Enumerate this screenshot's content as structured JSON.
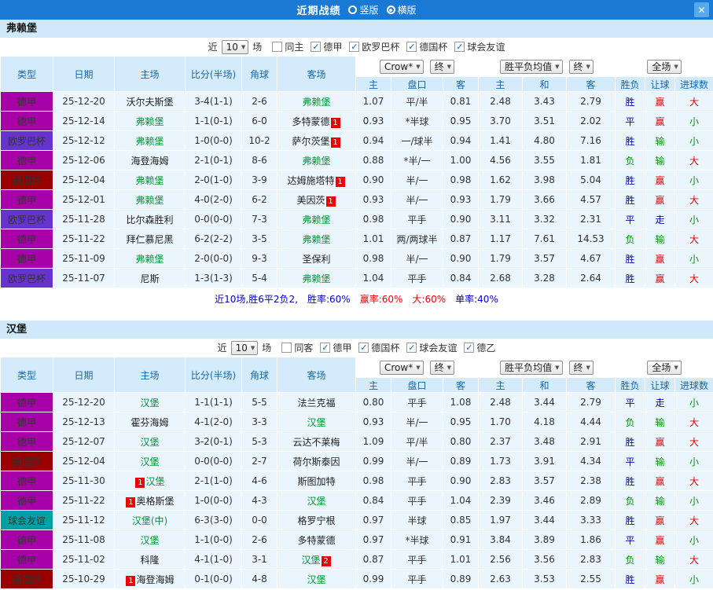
{
  "topbar": {
    "title": "近期战绩",
    "radios": [
      {
        "label": "竖版",
        "selected": false
      },
      {
        "label": "横版",
        "selected": true
      }
    ],
    "close_icon": "✕"
  },
  "filter_near": "近",
  "filter_games": "场",
  "table_header": {
    "type": "类型",
    "date": "日期",
    "home": "主场",
    "score": "比分(半场)",
    "corner": "角球",
    "away": "客场",
    "odds_select": "Crow*",
    "odds_final_select": "终",
    "avg_select": "胜平负均值",
    "avg_final_select": "终",
    "scope_select": "全场",
    "sub": [
      "主",
      "盘口",
      "客",
      "主",
      "和",
      "客",
      "胜负",
      "让球",
      "进球数"
    ]
  },
  "type_colors": {
    "德甲": "#a800a8",
    "欧罗巴杯": "#6633cc",
    "德国杯": "#990000",
    "球会友谊": "#00a0a5"
  },
  "result_colors": {
    "胜": "#0000dd",
    "平": "#0000dd",
    "负": "#009900",
    "赢": "#ee0000",
    "输": "#009900",
    "走": "#0000dd",
    "大": "#ee0000",
    "小": "#009900"
  },
  "sections": [
    {
      "team": "弗赖堡",
      "match_count": "10",
      "filters": [
        {
          "label": "同主",
          "checked": false
        },
        {
          "label": "德甲",
          "checked": true
        },
        {
          "label": "欧罗巴杯",
          "checked": true
        },
        {
          "label": "德国杯",
          "checked": true
        },
        {
          "label": "球会友谊",
          "checked": true
        }
      ],
      "rows": [
        {
          "type": "德甲",
          "date": "25-12-20",
          "home": "沃尔夫斯堡",
          "score": "3-4(1-1)",
          "corner": "2-6",
          "away": "弗赖堡",
          "away_focus": true,
          "odds": [
            "1.07",
            "平/半",
            "0.81"
          ],
          "avg": [
            "2.48",
            "3.43",
            "2.79"
          ],
          "res": [
            "胜",
            "赢",
            "大"
          ]
        },
        {
          "type": "德甲",
          "date": "25-12-14",
          "home": "弗赖堡",
          "home_focus": true,
          "score": "1-1(0-1)",
          "corner": "6-0",
          "away": "多特蒙德",
          "away_badge_post": "1",
          "odds": [
            "0.93",
            "*半球",
            "0.95"
          ],
          "avg": [
            "3.70",
            "3.51",
            "2.02"
          ],
          "res": [
            "平",
            "赢",
            "小"
          ]
        },
        {
          "type": "欧罗巴杯",
          "date": "25-12-12",
          "home": "弗赖堡",
          "home_focus": true,
          "score": "1-0(0-0)",
          "corner": "10-2",
          "away": "萨尔茨堡",
          "away_badge_post": "1",
          "odds": [
            "0.94",
            "一/球半",
            "0.94"
          ],
          "avg": [
            "1.41",
            "4.80",
            "7.16"
          ],
          "res": [
            "胜",
            "输",
            "小"
          ]
        },
        {
          "type": "德甲",
          "date": "25-12-06",
          "home": "海登海姆",
          "score": "2-1(0-1)",
          "corner": "8-6",
          "away": "弗赖堡",
          "away_focus": true,
          "odds": [
            "0.88",
            "*半/一",
            "1.00"
          ],
          "avg": [
            "4.56",
            "3.55",
            "1.81"
          ],
          "res": [
            "负",
            "输",
            "大"
          ]
        },
        {
          "type": "德国杯",
          "date": "25-12-04",
          "home": "弗赖堡",
          "home_focus": true,
          "score": "2-0(1-0)",
          "corner": "3-9",
          "away": "达姆施塔特",
          "away_badge_post": "1",
          "odds": [
            "0.90",
            "半/一",
            "0.98"
          ],
          "avg": [
            "1.62",
            "3.98",
            "5.04"
          ],
          "res": [
            "胜",
            "赢",
            "小"
          ]
        },
        {
          "type": "德甲",
          "date": "25-12-01",
          "home": "弗赖堡",
          "home_focus": true,
          "score": "4-0(2-0)",
          "corner": "6-2",
          "away": "美因茨",
          "away_badge_post": "1",
          "odds": [
            "0.93",
            "半/一",
            "0.93"
          ],
          "avg": [
            "1.79",
            "3.66",
            "4.57"
          ],
          "res": [
            "胜",
            "赢",
            "大"
          ]
        },
        {
          "type": "欧罗巴杯",
          "date": "25-11-28",
          "home": "比尔森胜利",
          "score": "0-0(0-0)",
          "corner": "7-3",
          "away": "弗赖堡",
          "away_focus": true,
          "odds": [
            "0.98",
            "平手",
            "0.90"
          ],
          "avg": [
            "3.11",
            "3.32",
            "2.31"
          ],
          "res": [
            "平",
            "走",
            "小"
          ]
        },
        {
          "type": "德甲",
          "date": "25-11-22",
          "home": "拜仁慕尼黑",
          "score": "6-2(2-2)",
          "corner": "3-5",
          "away": "弗赖堡",
          "away_focus": true,
          "odds": [
            "1.01",
            "两/两球半",
            "0.87"
          ],
          "avg": [
            "1.17",
            "7.61",
            "14.53"
          ],
          "res": [
            "负",
            "输",
            "大"
          ]
        },
        {
          "type": "德甲",
          "date": "25-11-09",
          "home": "弗赖堡",
          "home_focus": true,
          "score": "2-0(0-0)",
          "corner": "9-3",
          "away": "圣保利",
          "odds": [
            "0.98",
            "半/一",
            "0.90"
          ],
          "avg": [
            "1.79",
            "3.57",
            "4.67"
          ],
          "res": [
            "胜",
            "赢",
            "小"
          ]
        },
        {
          "type": "欧罗巴杯",
          "date": "25-11-07",
          "home": "尼斯",
          "score": "1-3(1-3)",
          "corner": "5-4",
          "away": "弗赖堡",
          "away_focus": true,
          "odds": [
            "1.04",
            "平手",
            "0.84"
          ],
          "avg": [
            "2.68",
            "3.28",
            "2.64"
          ],
          "res": [
            "胜",
            "赢",
            "大"
          ]
        }
      ],
      "summary": [
        {
          "text": "近10场,胜6平2负2,",
          "color": "#0000cc"
        },
        {
          "text": "胜率:60%",
          "color": "#0000cc"
        },
        {
          "text": "赢率:60%",
          "color": "#ee0000"
        },
        {
          "text": "大:60%",
          "color": "#ee0000"
        },
        {
          "text": "单率:40%",
          "color": "#0000cc"
        }
      ]
    },
    {
      "team": "汉堡",
      "match_count": "10",
      "filters": [
        {
          "label": "同客",
          "checked": false
        },
        {
          "label": "德甲",
          "checked": true
        },
        {
          "label": "德国杯",
          "checked": true
        },
        {
          "label": "球会友谊",
          "checked": true
        },
        {
          "label": "德乙",
          "checked": true
        }
      ],
      "rows": [
        {
          "type": "德甲",
          "date": "25-12-20",
          "home": "汉堡",
          "home_focus": true,
          "score": "1-1(1-1)",
          "corner": "5-5",
          "away": "法兰克福",
          "odds": [
            "0.80",
            "平手",
            "1.08"
          ],
          "avg": [
            "2.48",
            "3.44",
            "2.79"
          ],
          "res": [
            "平",
            "走",
            "小"
          ]
        },
        {
          "type": "德甲",
          "date": "25-12-13",
          "home": "霍芬海姆",
          "score": "4-1(2-0)",
          "corner": "3-3",
          "away": "汉堡",
          "away_focus": true,
          "odds": [
            "0.93",
            "半/一",
            "0.95"
          ],
          "avg": [
            "1.70",
            "4.18",
            "4.44"
          ],
          "res": [
            "负",
            "输",
            "大"
          ]
        },
        {
          "type": "德甲",
          "date": "25-12-07",
          "home": "汉堡",
          "home_focus": true,
          "score": "3-2(0-1)",
          "corner": "5-3",
          "away": "云达不莱梅",
          "odds": [
            "1.09",
            "平/半",
            "0.80"
          ],
          "avg": [
            "2.37",
            "3.48",
            "2.91"
          ],
          "res": [
            "胜",
            "赢",
            "大"
          ]
        },
        {
          "type": "德国杯",
          "date": "25-12-04",
          "home": "汉堡",
          "home_focus": true,
          "score": "0-0(0-0)",
          "corner": "2-7",
          "away": "荷尔斯泰因",
          "odds": [
            "0.99",
            "半/一",
            "0.89"
          ],
          "avg": [
            "1.73",
            "3.91",
            "4.34"
          ],
          "res": [
            "平",
            "输",
            "小"
          ]
        },
        {
          "type": "德甲",
          "date": "25-11-30",
          "home": "汉堡",
          "home_focus": true,
          "home_badge_pre": "1",
          "score": "2-1(1-0)",
          "corner": "4-6",
          "away": "斯图加特",
          "odds": [
            "0.98",
            "平手",
            "0.90"
          ],
          "avg": [
            "2.83",
            "3.57",
            "2.38"
          ],
          "res": [
            "胜",
            "赢",
            "大"
          ]
        },
        {
          "type": "德甲",
          "date": "25-11-22",
          "home": "奥格斯堡",
          "home_badge_pre": "1",
          "score": "1-0(0-0)",
          "corner": "4-3",
          "away": "汉堡",
          "away_focus": true,
          "odds": [
            "0.84",
            "平手",
            "1.04"
          ],
          "avg": [
            "2.39",
            "3.46",
            "2.89"
          ],
          "res": [
            "负",
            "输",
            "小"
          ]
        },
        {
          "type": "球会友谊",
          "date": "25-11-12",
          "home": "汉堡(中)",
          "home_focus": true,
          "score": "6-3(3-0)",
          "corner": "0-0",
          "away": "格罗宁根",
          "odds": [
            "0.97",
            "半球",
            "0.85"
          ],
          "avg": [
            "1.97",
            "3.44",
            "3.33"
          ],
          "res": [
            "胜",
            "赢",
            "大"
          ]
        },
        {
          "type": "德甲",
          "date": "25-11-08",
          "home": "汉堡",
          "home_focus": true,
          "score": "1-1(0-0)",
          "corner": "2-6",
          "away": "多特蒙德",
          "odds": [
            "0.97",
            "*半球",
            "0.91"
          ],
          "avg": [
            "3.84",
            "3.89",
            "1.86"
          ],
          "res": [
            "平",
            "赢",
            "小"
          ]
        },
        {
          "type": "德甲",
          "date": "25-11-02",
          "home": "科隆",
          "score": "4-1(1-0)",
          "corner": "3-1",
          "away": "汉堡",
          "away_focus": true,
          "away_badge_post": "2",
          "odds": [
            "0.87",
            "平手",
            "1.01"
          ],
          "avg": [
            "2.56",
            "3.56",
            "2.83"
          ],
          "res": [
            "负",
            "输",
            "大"
          ]
        },
        {
          "type": "德国杯",
          "date": "25-10-29",
          "home": "海登海姆",
          "home_badge_pre": "1",
          "score": "0-1(0-0)",
          "corner": "4-8",
          "away": "汉堡",
          "away_focus": true,
          "odds": [
            "0.99",
            "平手",
            "0.89"
          ],
          "avg": [
            "2.63",
            "3.53",
            "2.55"
          ],
          "res": [
            "胜",
            "赢",
            "小"
          ]
        }
      ],
      "summary": []
    }
  ]
}
